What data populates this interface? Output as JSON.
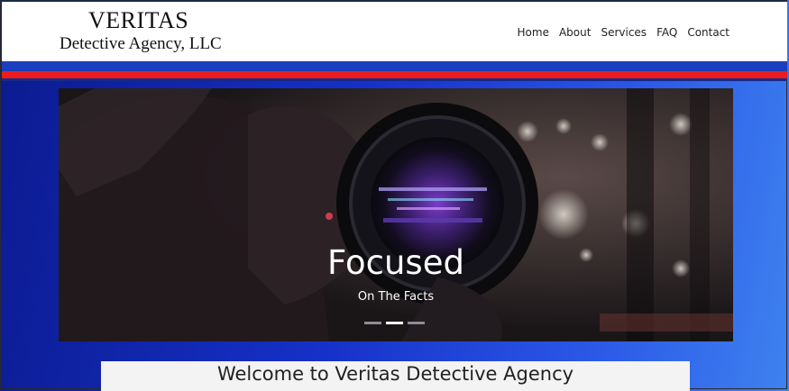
{
  "brand": {
    "line1": "VERITAS",
    "line2": "Detective Agency, LLC"
  },
  "nav": {
    "items": [
      "Home",
      "About",
      "Services",
      "FAQ",
      "Contact"
    ]
  },
  "carousel": {
    "title": "Focused",
    "subtitle": "On The Facts",
    "slide_count": 3,
    "active_slide": 2
  },
  "welcome": {
    "heading": "Welcome to Veritas Detective Agency"
  },
  "colors": {
    "stripe_blue": "#1b3fbf",
    "stripe_red": "#ee1b1b",
    "background_start": "#0b1a8e",
    "background_end": "#3e82f0"
  }
}
